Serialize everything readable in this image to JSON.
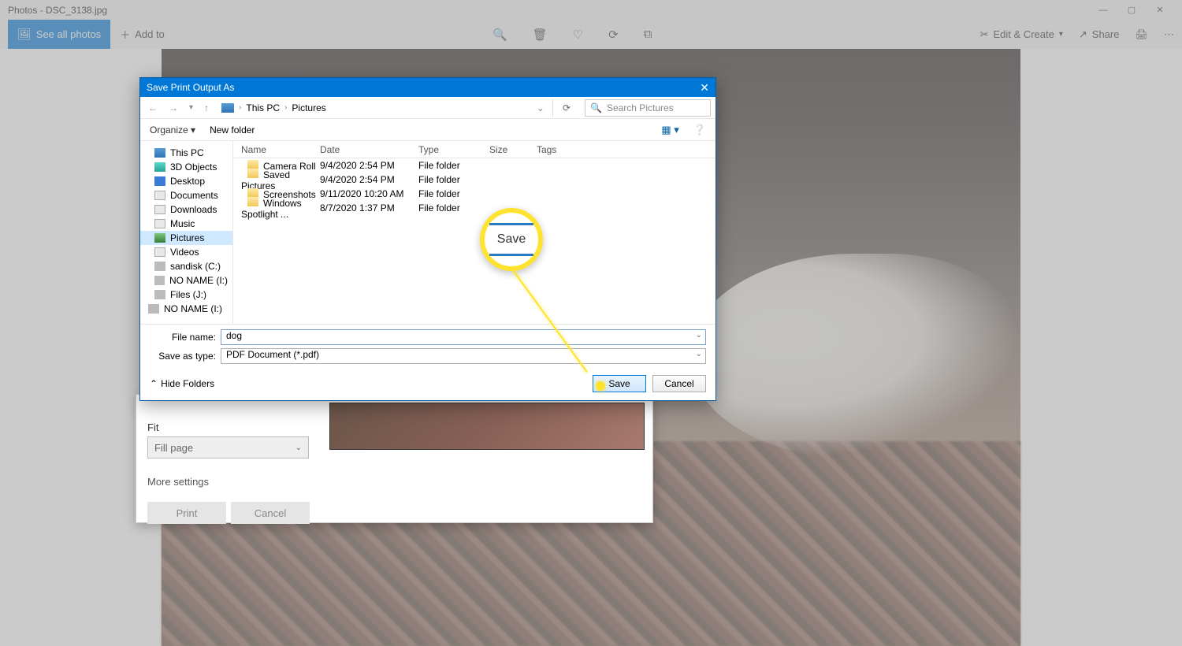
{
  "app": {
    "title": "Photos - DSC_3138.jpg",
    "minimize": "—",
    "restore": "▢",
    "close": "✕"
  },
  "toolbar": {
    "see_all": "See all photos",
    "add_to": "Add to",
    "edit_create": "Edit & Create",
    "share": "Share"
  },
  "print_panel": {
    "fit_label": "Fit",
    "fit_value": "Fill page",
    "more": "More settings",
    "print": "Print",
    "cancel": "Cancel"
  },
  "save": {
    "title": "Save Print Output As",
    "bc_root": "This PC",
    "bc_folder": "Pictures",
    "search_ph": "Search Pictures",
    "organize": "Organize",
    "new_folder": "New folder",
    "columns": {
      "name": "Name",
      "date": "Date",
      "type": "Type",
      "size": "Size",
      "tags": "Tags"
    },
    "tree": {
      "thispc": "This PC",
      "objects3d": "3D Objects",
      "desktop": "Desktop",
      "documents": "Documents",
      "downloads": "Downloads",
      "music": "Music",
      "pictures": "Pictures",
      "videos": "Videos",
      "sandisk": "sandisk (C:)",
      "noname_k": "NO NAME (I:)",
      "files_j": "Files (J:)",
      "noname_i": "NO NAME (I:)"
    },
    "rows": [
      {
        "name": "Camera Roll",
        "date": "9/4/2020 2:54 PM",
        "type": "File folder"
      },
      {
        "name": "Saved Pictures",
        "date": "9/4/2020 2:54 PM",
        "type": "File folder"
      },
      {
        "name": "Screenshots",
        "date": "9/11/2020 10:20 AM",
        "type": "File folder"
      },
      {
        "name": "Windows Spotlight ...",
        "date": "8/7/2020 1:37 PM",
        "type": "File folder"
      }
    ],
    "filename_label": "File name:",
    "filename_value": "dog",
    "type_label": "Save as type:",
    "type_value": "PDF Document (*.pdf)",
    "hide_folders": "Hide Folders",
    "save_btn": "Save",
    "cancel_btn": "Cancel"
  },
  "magnifier": {
    "text": "Save"
  }
}
